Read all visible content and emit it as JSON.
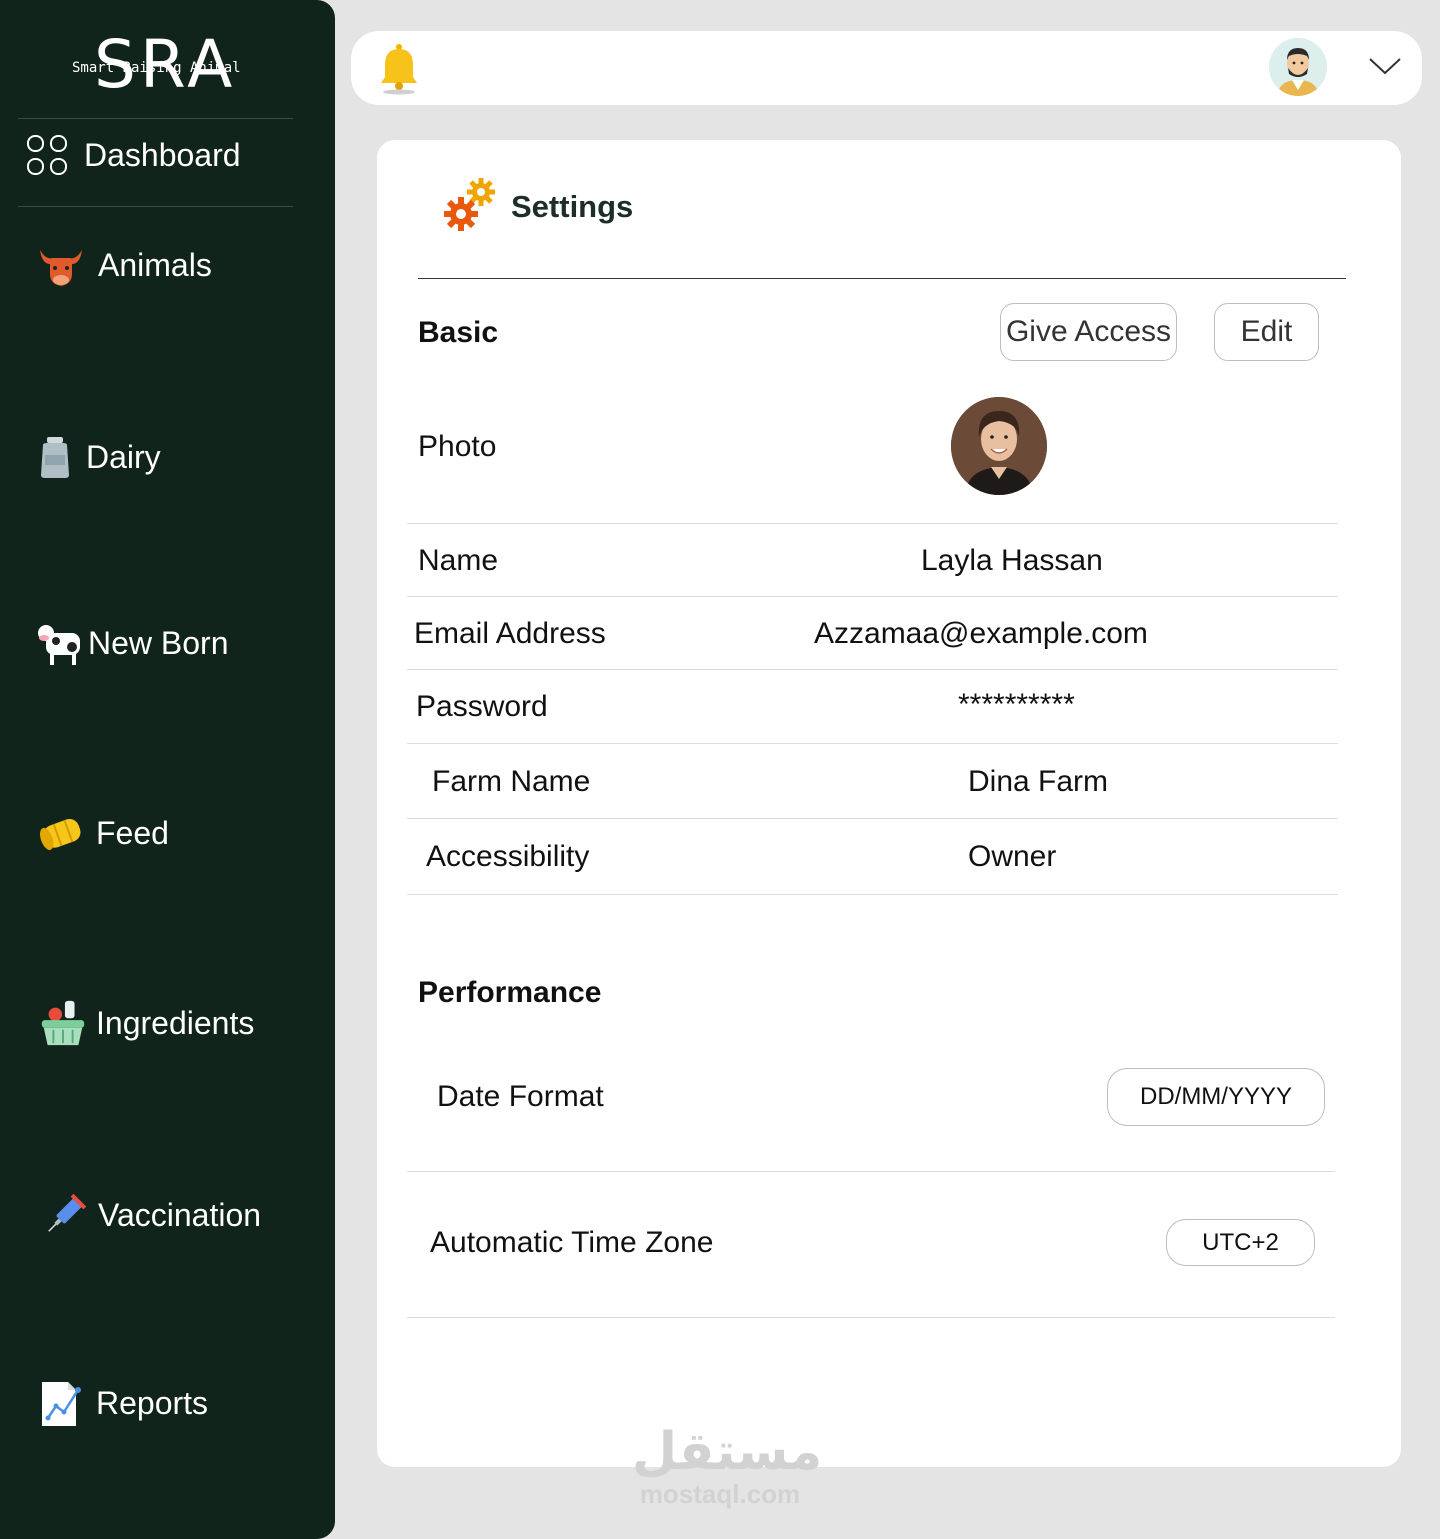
{
  "brand": {
    "logo_big": "SRA",
    "logo_small": "Smart Raising Animal"
  },
  "sidebar": {
    "items": [
      {
        "label": "Dashboard",
        "icon": "dashboard-grid-icon"
      },
      {
        "label": "Animals",
        "icon": "bull-head-icon"
      },
      {
        "label": "Dairy",
        "icon": "milk-can-icon"
      },
      {
        "label": "New Born",
        "icon": "cow-icon"
      },
      {
        "label": "Feed",
        "icon": "hay-bale-icon"
      },
      {
        "label": "Ingredients",
        "icon": "ingredients-basket-icon"
      },
      {
        "label": "Vaccination",
        "icon": "syringe-icon"
      },
      {
        "label": "Reports",
        "icon": "report-chart-icon"
      }
    ]
  },
  "topbar": {
    "bell_icon": "bell-icon",
    "avatar_icon": "user-avatar-icon",
    "menu_icon": "chevron-down-icon"
  },
  "settings": {
    "title": "Settings",
    "basic": {
      "title": "Basic",
      "give_access_label": "Give Access",
      "edit_label": "Edit",
      "rows": {
        "photo": {
          "label": "Photo"
        },
        "name": {
          "label": "Name",
          "value": "Layla Hassan"
        },
        "email": {
          "label": "Email Address",
          "value": "Azzamaa@example.com"
        },
        "password": {
          "label": "Password",
          "value": "**********"
        },
        "farm": {
          "label": "Farm Name",
          "value": "Dina Farm"
        },
        "access": {
          "label": "Accessibility",
          "value": "Owner"
        }
      }
    },
    "performance": {
      "title": "Performance",
      "date_format": {
        "label": "Date Format",
        "value": "DD/MM/YYYY"
      },
      "time_zone": {
        "label": "Automatic Time Zone",
        "value": "UTC+2"
      }
    }
  },
  "watermark": {
    "arabic": "مستقل",
    "latin": "mostaql.com"
  },
  "colors": {
    "sidebar_bg": "#11241c",
    "page_bg": "#e4e4e4",
    "card_bg": "#ffffff",
    "gear_orange": "#e8590c",
    "gear_yellow": "#f0a500"
  }
}
